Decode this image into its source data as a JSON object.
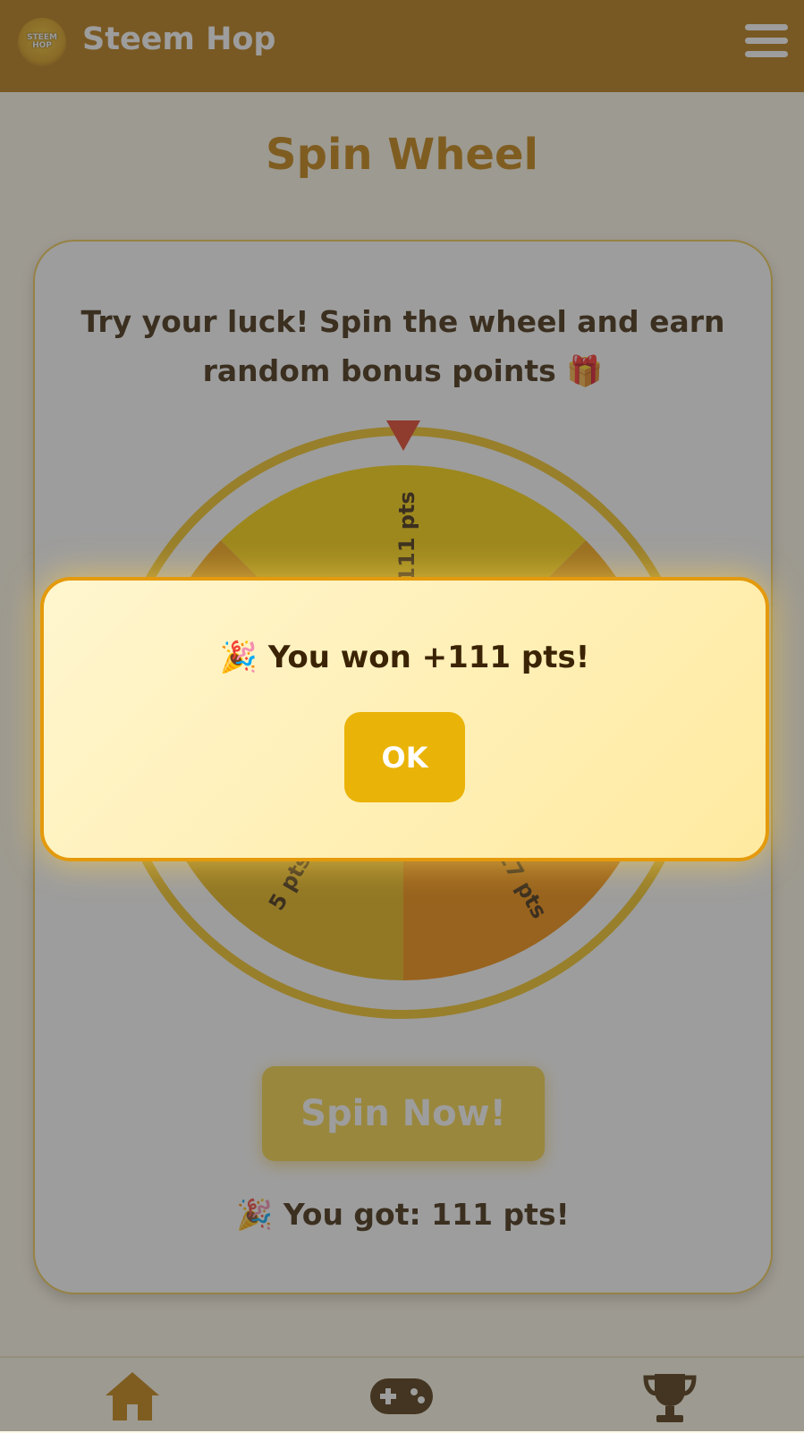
{
  "header": {
    "logo_text_line1": "STEEM",
    "logo_text_line2": "HOP",
    "brand": "Steem Hop"
  },
  "page": {
    "title": "Spin Wheel",
    "intro_line1": "Try your luck! Spin the wheel and earn",
    "intro_line2": "random bonus points 🎁"
  },
  "wheel": {
    "visible_labels": [
      "111 pts",
      "17 pts",
      "5 pts"
    ],
    "colors": {
      "segment_a": "#ffd400",
      "segment_b": "#f6a208",
      "segment_c": "#e8b40e",
      "segment_d": "#f58a00",
      "ring": "#f5c21a",
      "pointer": "#e33b1f"
    }
  },
  "spin_button": "Spin Now!",
  "result_text": "🎉 You got: 111 pts!",
  "modal": {
    "message": "🎉 You won +111 pts!",
    "ok_label": "OK"
  },
  "nav": {
    "icons": [
      "home-icon",
      "gamepad-icon",
      "trophy-icon"
    ]
  },
  "colors": {
    "header_bg": "#b7770a",
    "accent": "#c27f06",
    "text_dark": "#3b2305"
  }
}
